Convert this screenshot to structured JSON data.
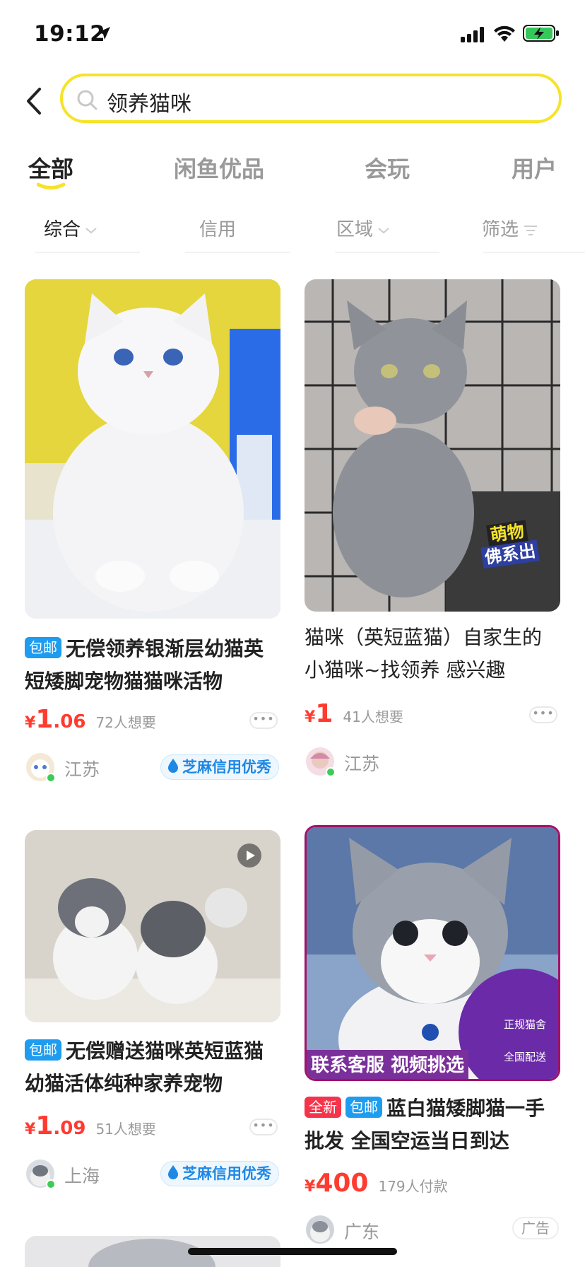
{
  "status_bar": {
    "time": "19:12"
  },
  "search": {
    "query": "领养猫咪"
  },
  "tabs": [
    {
      "label": "全部"
    },
    {
      "label": "闲鱼优品"
    },
    {
      "label": "会玩"
    },
    {
      "label": "用户"
    }
  ],
  "filters": [
    {
      "label": "综合"
    },
    {
      "label": "信用"
    },
    {
      "label": "区域"
    },
    {
      "label": "筛选"
    }
  ],
  "listings": [
    {
      "tags": [
        "包邮"
      ],
      "title": "无偿领养银渐层幼猫英短矮脚宠物猫猫咪活物",
      "price_symbol": "¥",
      "price_int": "1",
      "price_dec": ".06",
      "wants": "72人想要",
      "location": "江苏",
      "credit": "芝麻信用优秀"
    },
    {
      "tags": [],
      "title": "猫咪（英短蓝猫）自家生的小猫咪~找领养 感兴趣",
      "price_symbol": "¥",
      "price_int": "1",
      "price_dec": "",
      "wants": "41人想要",
      "location": "江苏",
      "image_overlay": {
        "line1": "萌物",
        "line2": "佛系出"
      }
    },
    {
      "tags": [
        "包邮"
      ],
      "title": "无偿赠送猫咪英短蓝猫幼猫活体纯种家养宠物",
      "price_symbol": "¥",
      "price_int": "1",
      "price_dec": ".09",
      "wants": "51人想要",
      "location": "上海",
      "credit": "芝麻信用优秀"
    },
    {
      "tags": [
        "全新",
        "包邮"
      ],
      "title": "蓝白猫矮脚猫一手批发 全国空运当日到达",
      "price_symbol": "¥",
      "price_int": "400",
      "price_dec": "",
      "wants": "179人付款",
      "location": "广东",
      "ad_label": "广告",
      "image_banner": "联系客服 视频挑选",
      "image_circle": {
        "line1": "正规猫舍",
        "line2": "全国配送"
      }
    }
  ],
  "colors": {
    "accent_yellow": "#f6e32a",
    "price_red": "#ff3b30",
    "tag_blue": "#1e9cf0",
    "tag_red": "#f5334a",
    "credit_blue": "#1e88e5"
  }
}
